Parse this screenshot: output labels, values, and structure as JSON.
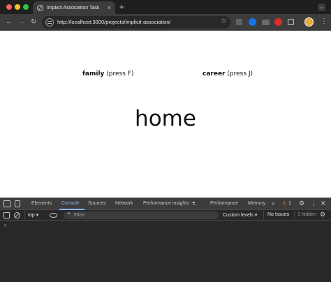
{
  "browser": {
    "tab_title": "Implicit Association Task",
    "new_tab": "+",
    "tab_close": "×",
    "url": "http://localhost:3000/projects/implicit-association/",
    "nav": {
      "back": "←",
      "forward": "→",
      "reload": "↻"
    },
    "star": "☆",
    "menu": "⋮"
  },
  "page": {
    "left_category": {
      "bold": "family",
      "hint": "(press F)"
    },
    "right_category": {
      "bold": "career",
      "hint": "(press J)"
    },
    "stimulus_word": "home"
  },
  "devtools": {
    "tabs": [
      "Elements",
      "Console",
      "Sources",
      "Network",
      "Performance insights",
      "Performance",
      "Memory"
    ],
    "active_tab": "Console",
    "more": "»",
    "warning_icon": "⚠",
    "warning_count": "1",
    "context": "top ▾",
    "filter_placeholder": "Filter",
    "levels": "Custom levels ▾",
    "issues": "No Issues",
    "hidden": "1 hidden",
    "prompt": "›",
    "icons": [
      "inspect-icon",
      "device-toggle-icon",
      "gear-icon",
      "kebab-menu-icon",
      "close-icon",
      "sidebar-icon",
      "clear-console-icon",
      "eye-icon",
      "filter-icon"
    ]
  },
  "colors": {
    "chrome_bg": "#1f1f1f",
    "toolbar_bg": "#3c3c3c",
    "devtools_bg": "#282828",
    "accent": "#8ab4f8"
  }
}
